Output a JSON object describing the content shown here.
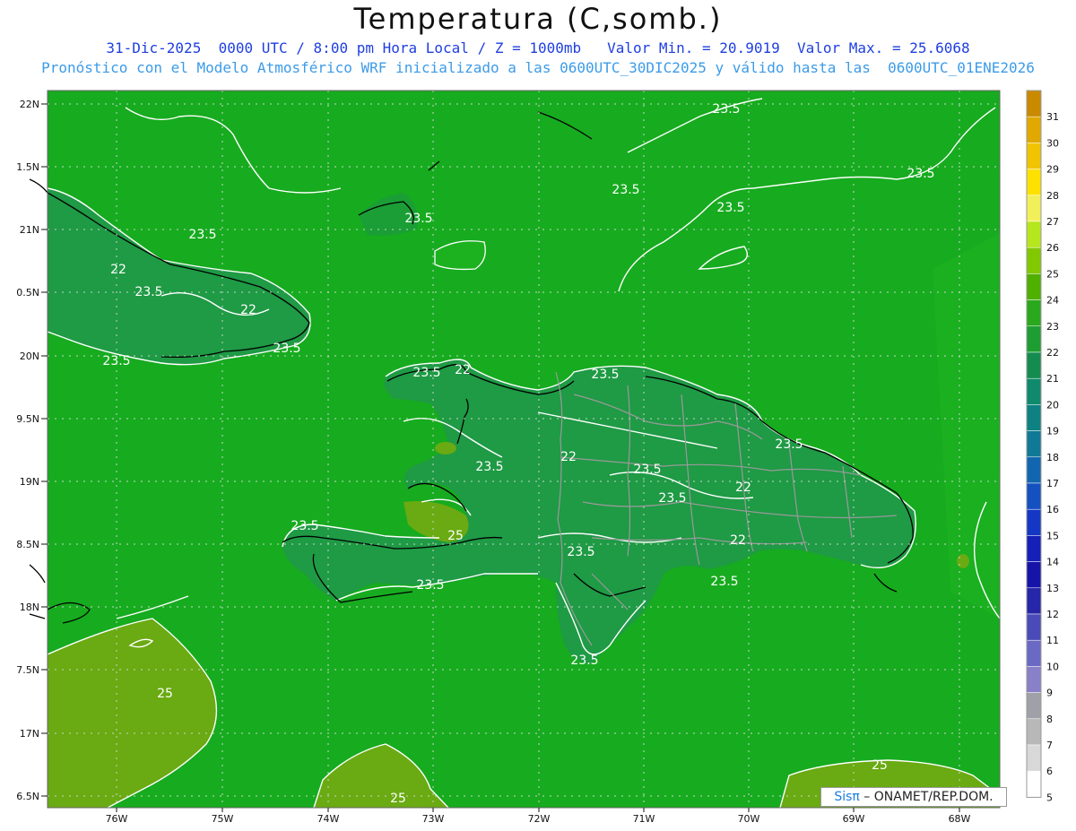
{
  "header": {
    "title": "Temperatura (C,somb.)",
    "line1": "31-Dic-2025  0000 UTC / 8:00 pm Hora Local / Z = 1000mb   Valor Min. = 20.9019  Valor Max. = 25.6068",
    "line2": "Pronóstico con el Modelo Atmosférico WRF inicializado a las 0600UTC_30DIC2025 y válido hasta las  0600UTC_01ENE2026"
  },
  "axes": {
    "lat_labels": [
      "22N",
      "1.5N",
      "21N",
      "0.5N",
      "20N",
      "9.5N",
      "19N",
      "8.5N",
      "18N",
      "7.5N",
      "17N",
      "6.5N"
    ],
    "lon_labels": [
      "76W",
      "75W",
      "74W",
      "73W",
      "72W",
      "71W",
      "70W",
      "69W",
      "68W"
    ]
  },
  "colorbar": {
    "labels": [
      "31",
      "30",
      "29",
      "28",
      "27",
      "26",
      "25",
      "24",
      "23",
      "22",
      "21",
      "20",
      "19",
      "18",
      "17",
      "16",
      "15",
      "14",
      "13",
      "12",
      "11",
      "10",
      "9",
      "8",
      "7",
      "6",
      "5"
    ],
    "colors": [
      "#c98a00",
      "#e0a800",
      "#f0c400",
      "#ffe100",
      "#f2f05a",
      "#b6e61e",
      "#82c800",
      "#4fb000",
      "#2aa81e",
      "#1e9e32",
      "#148c50",
      "#108a6c",
      "#0e8282",
      "#107a96",
      "#1266b0",
      "#1450c0",
      "#1438c4",
      "#1420b8",
      "#1614a8",
      "#2626a8",
      "#4a4ab8",
      "#6a6ac4",
      "#8880c8",
      "#a0a0a8",
      "#b8b8b8",
      "#d8d8d8",
      "#ffffff"
    ]
  },
  "contour_labels": [
    "23.5",
    "23.5",
    "23.5",
    "23.5",
    "23.5",
    "23.5",
    "22",
    "23.5",
    "22",
    "23.5",
    "23.5",
    "23.5",
    "22",
    "23.5",
    "22",
    "23.5",
    "23.5",
    "23.5",
    "22",
    "23.5",
    "25",
    "23.5",
    "23.5",
    "22",
    "23.5",
    "23.5",
    "23.5",
    "25",
    "25",
    "25"
  ],
  "credit": {
    "logo": "Sisπ",
    "text": " – ONAMET/REP.DOM."
  },
  "colors": {
    "base_green": "#17ab1f",
    "land_dark": "#1f9a45",
    "land_mid": "#2aa63a",
    "olive": "#6aaa12"
  }
}
